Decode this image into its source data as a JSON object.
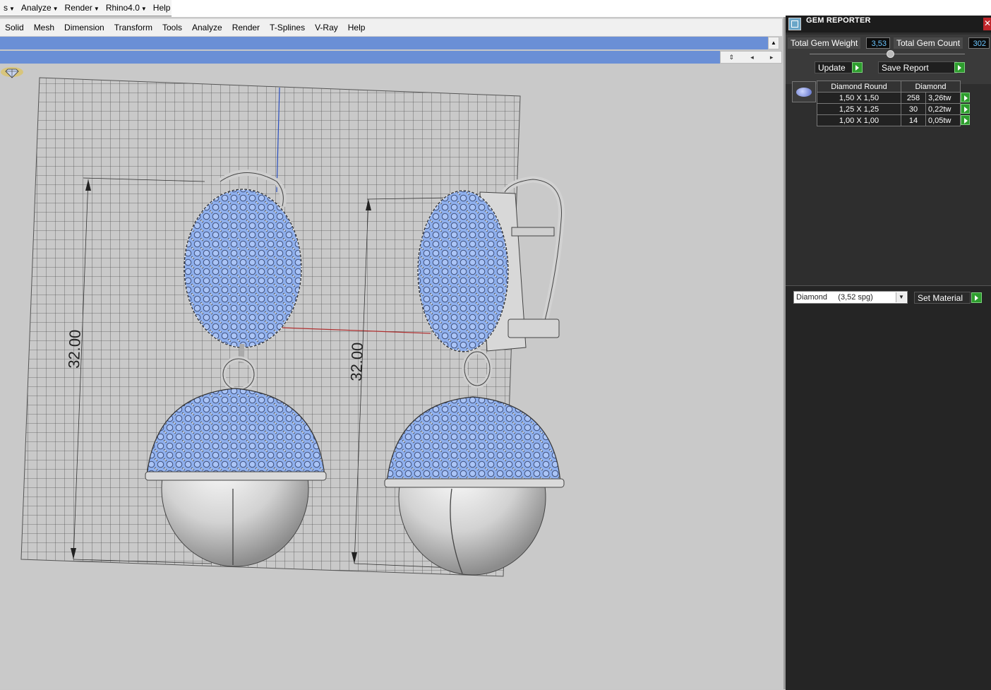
{
  "top_menu": {
    "items": [
      "s",
      "Analyze",
      "Render",
      "Rhino4.0",
      "Help"
    ]
  },
  "menubar": {
    "items": [
      "Solid",
      "Mesh",
      "Dimension",
      "Transform",
      "Tools",
      "Analyze",
      "Render",
      "T-Splines",
      "V-Ray",
      "Help"
    ]
  },
  "viewport": {
    "dimension_left": "32.00",
    "dimension_right": "32.00"
  },
  "gem_reporter": {
    "title": "GEM REPORTER",
    "total_weight_label": "Total Gem Weight",
    "total_weight_value": "3,53",
    "total_count_label": "Total Gem Count",
    "total_count_value": "302",
    "update_label": "Update",
    "save_report_label": "Save Report",
    "table": {
      "headers": [
        "Diamond Round",
        "Diamond"
      ],
      "rows": [
        {
          "size": "1,50 X 1,50",
          "count": "258",
          "weight": "3,26tw"
        },
        {
          "size": "1,25 X 1,25",
          "count": "30",
          "weight": "0,22tw"
        },
        {
          "size": "1,00 X 1,00",
          "count": "14",
          "weight": "0,05tw"
        }
      ]
    },
    "material_select": "Diamond     (3,52 spg)",
    "set_material_label": "Set Material"
  },
  "colors": {
    "command_bar": "#6a8fd6",
    "panel_bg": "#2e2e2e",
    "gem_blue": "#8fb0ee",
    "accent_green": "#2e9e2e"
  }
}
